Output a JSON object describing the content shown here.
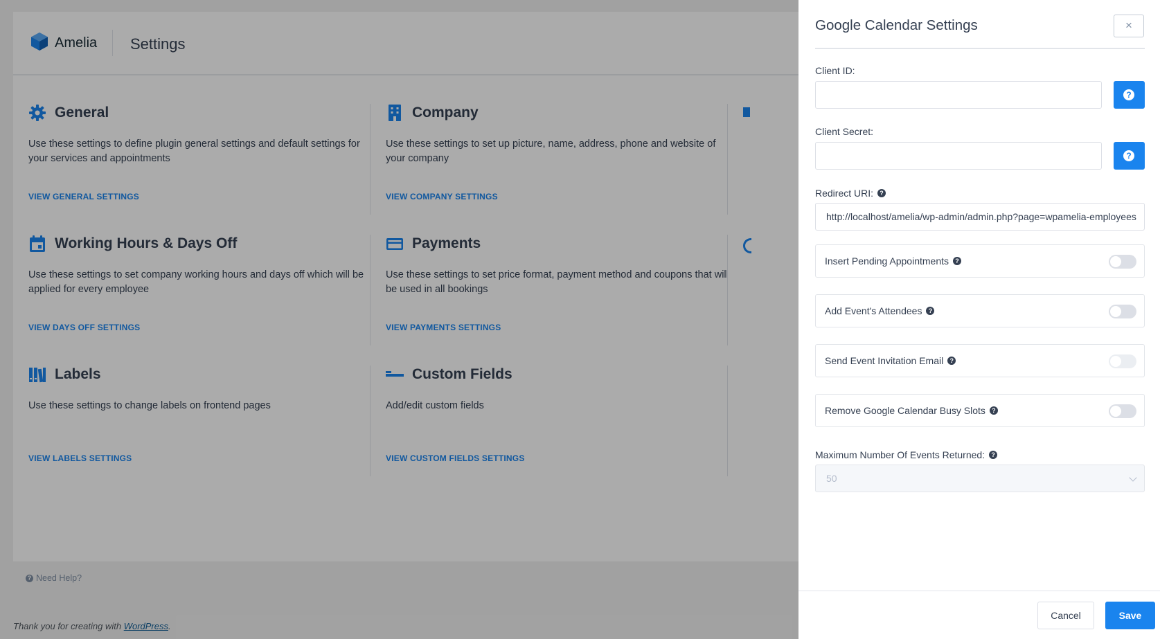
{
  "header": {
    "logo_text": "Amelia",
    "title": "Settings"
  },
  "tiles": {
    "general": {
      "title": "General",
      "description": "Use these settings to define plugin general settings and default settings for your services and appointments",
      "link": "VIEW GENERAL SETTINGS"
    },
    "company": {
      "title": "Company",
      "description": "Use these settings to set up picture, name, address, phone and website of your company",
      "link": "VIEW COMPANY SETTINGS"
    },
    "working_hours": {
      "title": "Working Hours & Days Off",
      "description": "Use these settings to set company working hours and days off which will be applied for every employee",
      "link": "VIEW DAYS OFF SETTINGS"
    },
    "payments": {
      "title": "Payments",
      "description": "Use these settings to set price format, payment method and coupons that will be used in all bookings",
      "link": "VIEW PAYMENTS SETTINGS"
    },
    "labels": {
      "title": "Labels",
      "description": "Use these settings to change labels on frontend pages",
      "link": "VIEW LABELS SETTINGS"
    },
    "custom_fields": {
      "title": "Custom Fields",
      "description": "Add/edit custom fields",
      "link": "VIEW CUSTOM FIELDS SETTINGS"
    }
  },
  "footer": {
    "need_help": "Need Help?",
    "thanks_prefix": "Thank you for creating with ",
    "wordpress_link": "WordPress",
    "thanks_suffix": "."
  },
  "panel": {
    "title": "Google Calendar Settings",
    "close": "×",
    "client_id_label": "Client ID:",
    "client_id_value": "",
    "client_secret_label": "Client Secret:",
    "client_secret_value": "",
    "redirect_uri_label": "Redirect URI:",
    "redirect_uri_value": "http://localhost/amelia/wp-admin/admin.php?page=wpamelia-employees",
    "toggles": {
      "insert_pending": {
        "label": "Insert Pending Appointments",
        "on": false
      },
      "add_attendees": {
        "label": "Add Event's Attendees",
        "on": false
      },
      "send_invitation": {
        "label": "Send Event Invitation Email",
        "on": false
      },
      "remove_busy": {
        "label": "Remove Google Calendar Busy Slots",
        "on": false
      }
    },
    "max_events_label": "Maximum Number Of Events Returned:",
    "max_events_value": "50",
    "cancel": "Cancel",
    "save": "Save"
  },
  "colors": {
    "accent": "#1a84ee",
    "text": "#354052",
    "overlay": "rgba(0,0,0,0.33)"
  }
}
